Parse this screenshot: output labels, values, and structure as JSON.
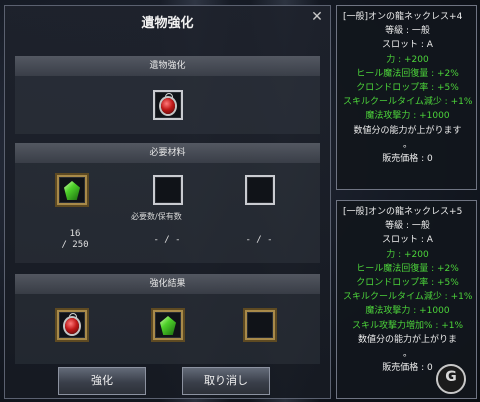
{
  "window": {
    "title": "遺物強化",
    "close_glyph": "✕"
  },
  "sections": {
    "relic": {
      "header": "遺物強化"
    },
    "materials": {
      "header": "必要材料",
      "subheader": "必要数/保有数",
      "counts": [
        "16\n/ 250",
        "- / -",
        "- / -"
      ]
    },
    "result": {
      "header": "強化結果"
    }
  },
  "buttons": {
    "enhance": "強化",
    "cancel": "取り消し"
  },
  "tooltip_top": {
    "lines": [
      {
        "text": "[一般]オンの龍ネックレス+4",
        "color": "white"
      },
      {
        "text": "等級 : 一般",
        "color": "white"
      },
      {
        "text": "スロット : A",
        "color": "white"
      },
      {
        "text": "力 : +200",
        "color": "green"
      },
      {
        "text": "ヒール魔法回復量 : +2%",
        "color": "green"
      },
      {
        "text": "クロンドロップ率 : +5%",
        "color": "green"
      },
      {
        "text": "スキルクールタイム減少 : +1%",
        "color": "green"
      },
      {
        "text": "魔法攻撃力 : +1000",
        "color": "green"
      },
      {
        "text": "数値分の能力が上がります",
        "color": "white"
      },
      {
        "text": "。",
        "color": "white"
      },
      {
        "text": "販売価格 : 0",
        "color": "white"
      }
    ]
  },
  "tooltip_bottom": {
    "lines": [
      {
        "text": "[一般]オンの龍ネックレス+5",
        "color": "white"
      },
      {
        "text": "等級 : 一般",
        "color": "white"
      },
      {
        "text": "スロット : A",
        "color": "white"
      },
      {
        "text": "力 : +200",
        "color": "green"
      },
      {
        "text": "ヒール魔法回復量 : +2%",
        "color": "green"
      },
      {
        "text": "クロンドロップ率 : +5%",
        "color": "green"
      },
      {
        "text": "スキルクールタイム減少 : +1%",
        "color": "green"
      },
      {
        "text": "魔法攻撃力 : +1000",
        "color": "green"
      },
      {
        "text": "スキル攻撃力増加% : +1%",
        "color": "green"
      },
      {
        "text": "数値分の能力が上がりま",
        "color": "white"
      },
      {
        "text": "。",
        "color": "white"
      },
      {
        "text": "販売価格 : 0",
        "color": "white"
      }
    ]
  },
  "watermark": "G",
  "colors": {
    "stat_green": "#4cd43a",
    "text_white": "#ececec",
    "gold_frame": "#a88a4a"
  },
  "icons": [
    "red-necklace-icon",
    "green-crystal-icon"
  ]
}
